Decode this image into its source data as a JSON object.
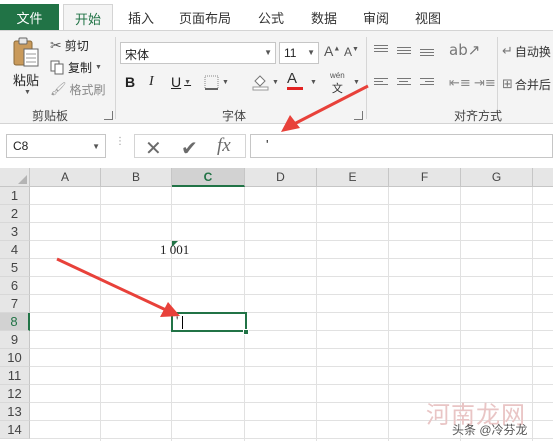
{
  "tabs": [
    {
      "label": "文件",
      "active": false
    },
    {
      "label": "开始",
      "active": true
    },
    {
      "label": "插入",
      "active": false
    },
    {
      "label": "页面布局",
      "active": false
    },
    {
      "label": "公式",
      "active": false
    },
    {
      "label": "数据",
      "active": false
    },
    {
      "label": "审阅",
      "active": false
    },
    {
      "label": "视图",
      "active": false
    }
  ],
  "ribbon": {
    "clipboard": {
      "paste_label": "粘贴",
      "cut_label": "剪切",
      "copy_label": "复制",
      "format_painter_label": "格式刷",
      "group_label": "剪贴板"
    },
    "font": {
      "font_name": "宋体",
      "font_size": "11",
      "bold": "B",
      "italic": "I",
      "underline": "U",
      "font_color_glyph": "A",
      "phonetic_top": "wén",
      "phonetic_bottom": "文",
      "group_label": "字体"
    },
    "alignment": {
      "wrap_text_label": "自动换",
      "merge_label": "合并后",
      "group_label": "对齐方式"
    }
  },
  "formula_bar": {
    "name_box": "C8",
    "cancel_glyph": "✕",
    "enter_glyph": "✔",
    "fx_label": "fx",
    "content": "'"
  },
  "grid": {
    "columns": [
      "A",
      "B",
      "C",
      "D",
      "E",
      "F",
      "G"
    ],
    "selected_column": "C",
    "rows": [
      "1",
      "2",
      "3",
      "4",
      "5",
      "6",
      "7",
      "8",
      "9",
      "10",
      "11",
      "12",
      "13",
      "14"
    ],
    "selected_row": "8",
    "cell_c4": "1 001",
    "cell_c8_editing": "'"
  },
  "watermark": {
    "brand": "河南龙网",
    "byline": "头条 @冷芬龙"
  },
  "colors": {
    "accent": "#217346",
    "arrow": "#e8413a",
    "font_color_bar": "#e22222"
  }
}
